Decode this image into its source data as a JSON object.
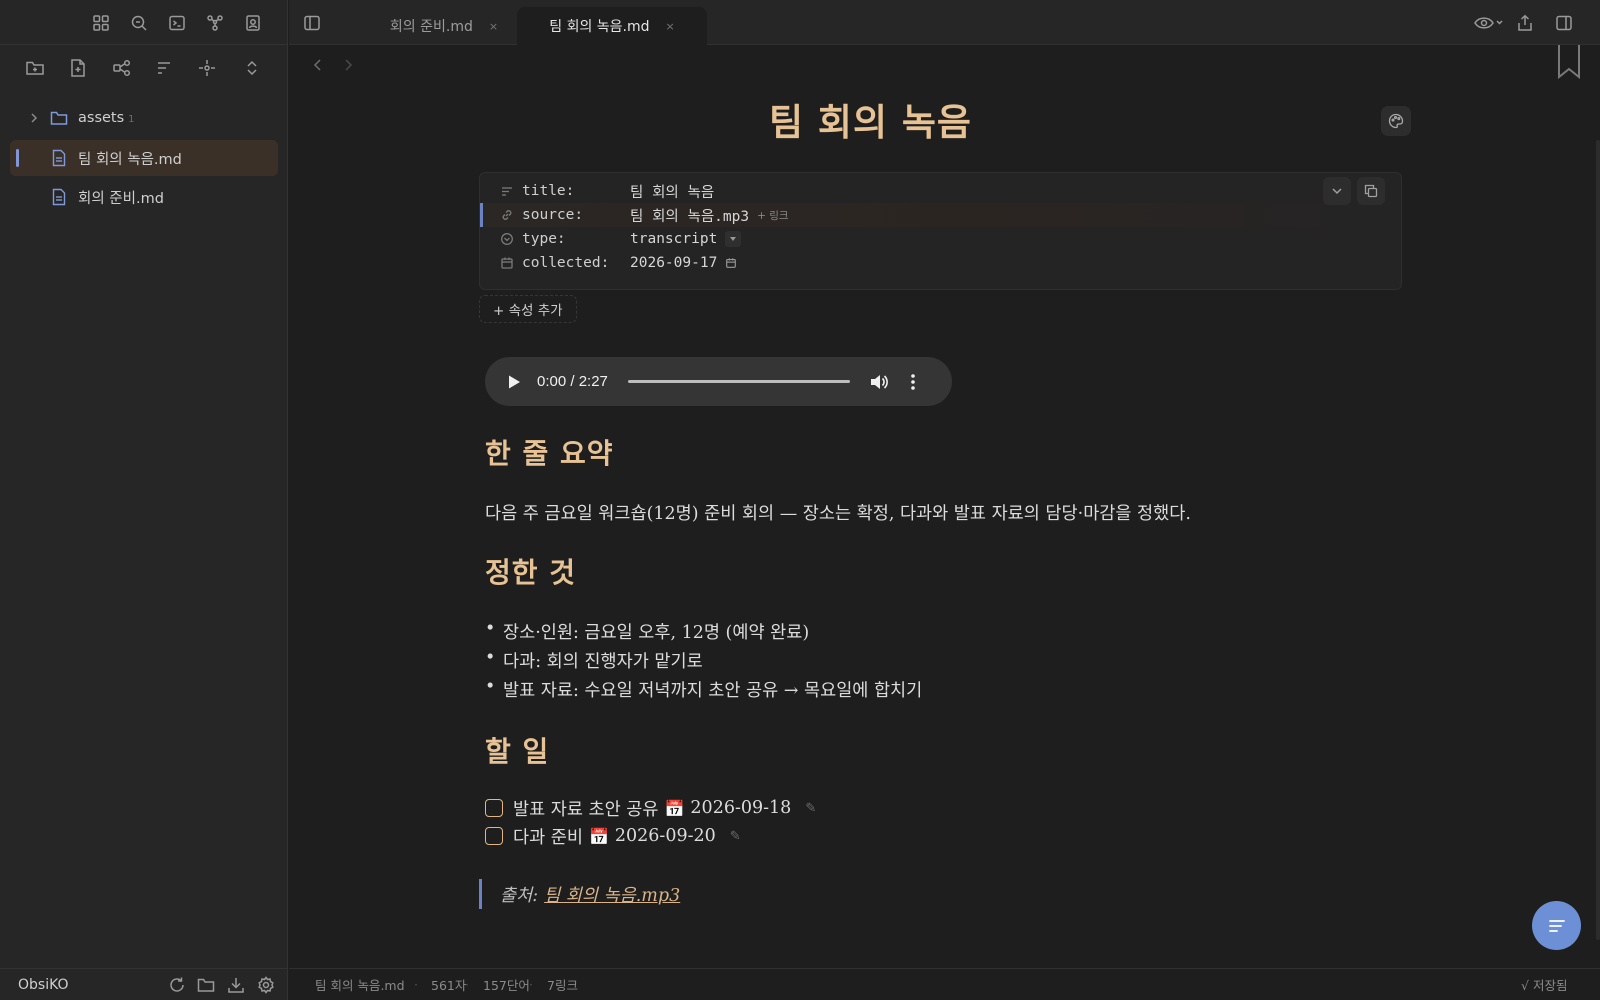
{
  "sidebar": {
    "ribbon_icons": [
      "layout-grid-icon",
      "search-icon",
      "terminal-icon",
      "graph-icon",
      "contact-card-icon"
    ],
    "toolbar_icons": [
      "new-folder-icon",
      "new-note-icon",
      "graph-nodes-icon",
      "sort-icon",
      "locate-icon",
      "expand-collapse-icon"
    ],
    "tree": [
      {
        "label": "assets",
        "count": "1",
        "type": "folder"
      },
      {
        "label": "팀 회의 녹음.md",
        "type": "file",
        "active": true
      },
      {
        "label": "회의 준비.md",
        "type": "file"
      }
    ],
    "vault_name": "ObsiKO"
  },
  "tabs": [
    {
      "label": "회의 준비.md",
      "close": "×",
      "active": false
    },
    {
      "label": "팀 회의 녹음.md",
      "close": "×",
      "active": true
    }
  ],
  "doc": {
    "title": "팀 회의 녹음",
    "properties": [
      {
        "key": "title:",
        "value": "팀 회의 녹음",
        "extra": "",
        "icon": "text-lines-icon"
      },
      {
        "key": "source:",
        "value": "팀 회의 녹음.mp3",
        "extra": "+ 링크",
        "icon": "link-icon"
      },
      {
        "key": "type:",
        "value": "transcript",
        "extra": "",
        "icon": "circle-chevron-icon"
      },
      {
        "key": "collected:",
        "value": "2026-09-17",
        "extra": "",
        "icon": "calendar-icon"
      }
    ],
    "add_property": "+ 속성 추가",
    "audio": {
      "time": "0:00 / 2:27",
      "progress": 0
    },
    "summary_heading": "한 줄 요약",
    "summary": "다음 주 금요일 워크숍(12명) 준비 회의 — 장소는 확정, 다과와 발표 자료의 담당·마감을 정했다.",
    "decided_heading": "정한 것",
    "decided": [
      "장소·인원: 금요일 오후, 12명 (예약 완료)",
      "다과: 회의 진행자가 맡기로",
      "발표 자료: 수요일 저녁까지 초안 공유 → 목요일에 합치기"
    ],
    "todo_heading": "할 일",
    "todos": [
      {
        "text": "발표 자료 초안 공유",
        "date": "2026-09-18",
        "emoji": "📅",
        "edit": "✎"
      },
      {
        "text": "다과 준비",
        "date": "2026-09-20",
        "emoji": "📅",
        "edit": "✎"
      }
    ],
    "quote_prefix": "출처:",
    "quote_link": "팀 회의 녹음.mp3",
    "bullet": "•"
  },
  "status": {
    "filename": "팀 회의 녹음.md",
    "chars": "561자",
    "words": "157단어",
    "links": "7링크",
    "saved": "√ 저장됨"
  },
  "colors": {
    "accent": "#e7c294",
    "link_accent": "#6c82c7",
    "fab": "#6c8fd6"
  }
}
